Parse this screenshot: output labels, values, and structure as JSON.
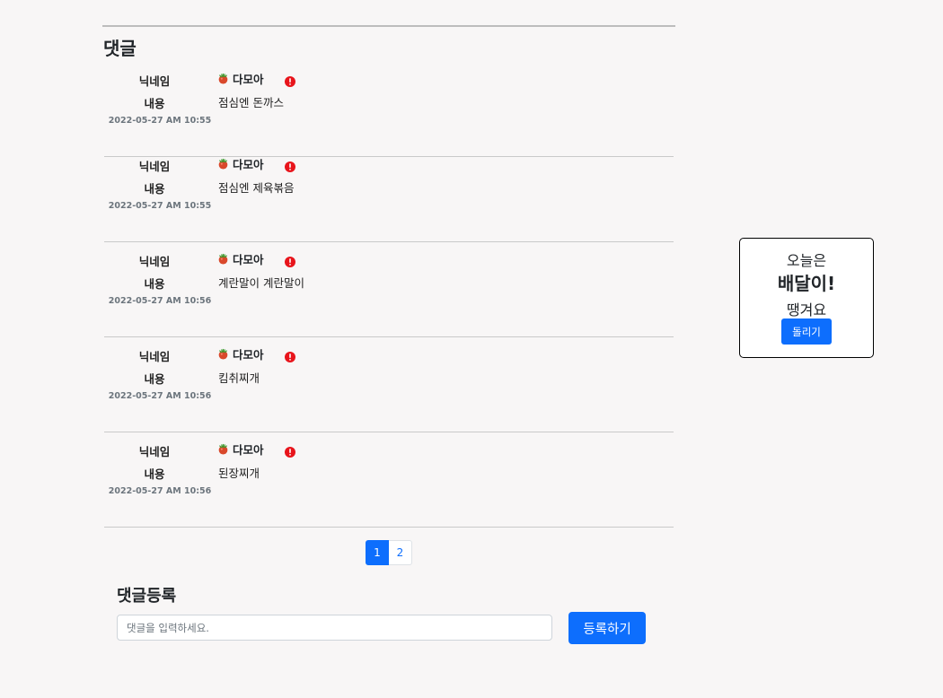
{
  "comments": {
    "title": "댓글",
    "items": [
      {
        "nickname_label": "닉네임",
        "author": "다모아",
        "content_label": "내용",
        "content": "점심엔 돈까스",
        "date": "2022-05-27 AM 10:55"
      },
      {
        "nickname_label": "닉네임",
        "author": "다모아",
        "content_label": "내용",
        "content": "점심엔 제육볶음",
        "date": "2022-05-27 AM 10:55"
      },
      {
        "nickname_label": "닉네임",
        "author": "다모아",
        "content_label": "내용",
        "content": "계란말이 계란말이",
        "date": "2022-05-27 AM 10:56"
      },
      {
        "nickname_label": "닉네임",
        "author": "다모아",
        "content_label": "내용",
        "content": "킴취찌개",
        "date": "2022-05-27 AM 10:56"
      },
      {
        "nickname_label": "닉네임",
        "author": "다모아",
        "content_label": "내용",
        "content": "된장찌개",
        "date": "2022-05-27 AM 10:56"
      }
    ],
    "icons": {
      "author": "tomato-icon",
      "report": "report-alert-icon"
    }
  },
  "pagination": {
    "pages": [
      "1",
      "2"
    ],
    "active": "1"
  },
  "comment_form": {
    "title": "댓글등록",
    "input_value": "",
    "placeholder": "댓글을 입력하세요.",
    "submit_label": "등록하기"
  },
  "roulette": {
    "line1": "오늘은",
    "line2": "배달이!",
    "line3": "땡겨요",
    "button_label": "돌리기"
  },
  "colors": {
    "accent": "#0d6efd",
    "report": "#e8141b",
    "background": "#f8f6f6"
  }
}
